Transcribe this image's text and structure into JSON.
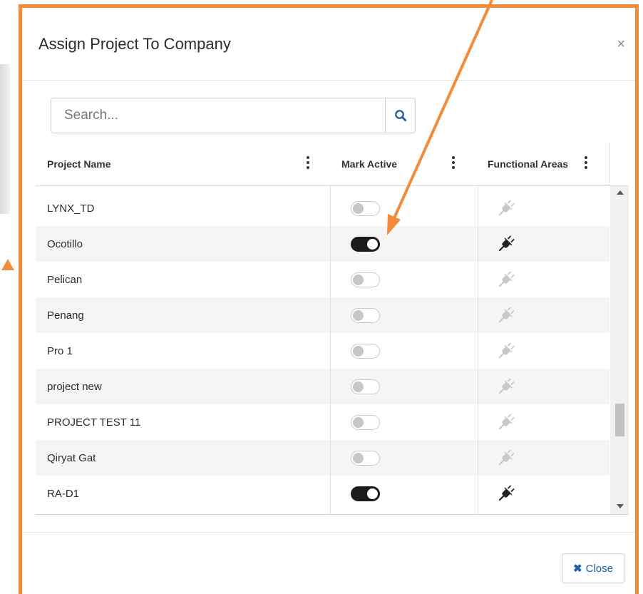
{
  "dialog": {
    "title": "Assign Project To Company",
    "close_glyph": "×"
  },
  "search": {
    "placeholder": "Search...",
    "value": "",
    "icon": "search-icon"
  },
  "grid": {
    "columns": [
      {
        "label": "Project Name"
      },
      {
        "label": "Mark Active"
      },
      {
        "label": "Functional Areas"
      }
    ],
    "rows": [
      {
        "name": "LYNX_TD",
        "active": false
      },
      {
        "name": "Ocotillo",
        "active": true
      },
      {
        "name": "Pelican",
        "active": false
      },
      {
        "name": "Penang",
        "active": false
      },
      {
        "name": "Pro 1",
        "active": false
      },
      {
        "name": "project new",
        "active": false
      },
      {
        "name": "PROJECT TEST 11",
        "active": false
      },
      {
        "name": "Qiryat Gat",
        "active": false
      },
      {
        "name": "RA-D1",
        "active": true
      }
    ]
  },
  "footer": {
    "close_label": "Close",
    "close_glyph": "✖"
  },
  "colors": {
    "accent_border": "#f28c3a",
    "button_text": "#1a5fa8",
    "toggle_on": "#1c1c1c",
    "toggle_off_knob": "#c7c7c7"
  }
}
